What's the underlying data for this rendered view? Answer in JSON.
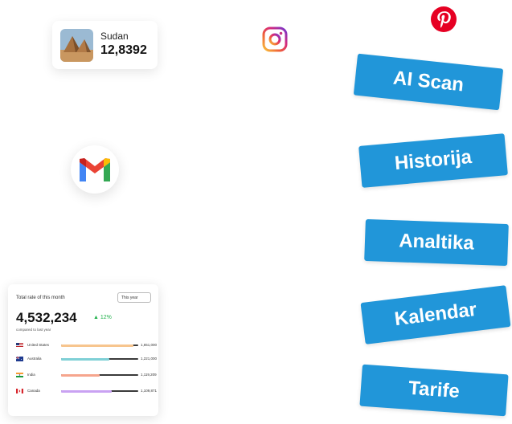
{
  "country_card": {
    "name": "Sudan",
    "value": "12,8392"
  },
  "icons": [
    "instagram-icon",
    "pinterest-icon",
    "gmail-icon"
  ],
  "tags": [
    {
      "label": "AI Scan"
    },
    {
      "label": "Historija"
    },
    {
      "label": "Analtika"
    },
    {
      "label": "Kalendar"
    },
    {
      "label": "Tarife"
    }
  ],
  "sales": {
    "title": "Total rate of this month",
    "period": "This year",
    "total": "4,532,234",
    "change": "12%",
    "subtitle": "compared to last year",
    "rows": [
      {
        "country": "United States",
        "value": "1,651,000",
        "fraction": 0.94,
        "color": "#f7c58e"
      },
      {
        "country": "Australia",
        "value": "1,221,000",
        "fraction": 0.63,
        "color": "#7fd0d6"
      },
      {
        "country": "India",
        "value": "1,119,209",
        "fraction": 0.5,
        "color": "#f6a58d"
      },
      {
        "country": "Canada",
        "value": "1,109,871",
        "fraction": 0.66,
        "color": "#c9a2f2"
      }
    ]
  },
  "colors": {
    "tag_blue": "#2196d9",
    "positive": "#22b14c"
  }
}
